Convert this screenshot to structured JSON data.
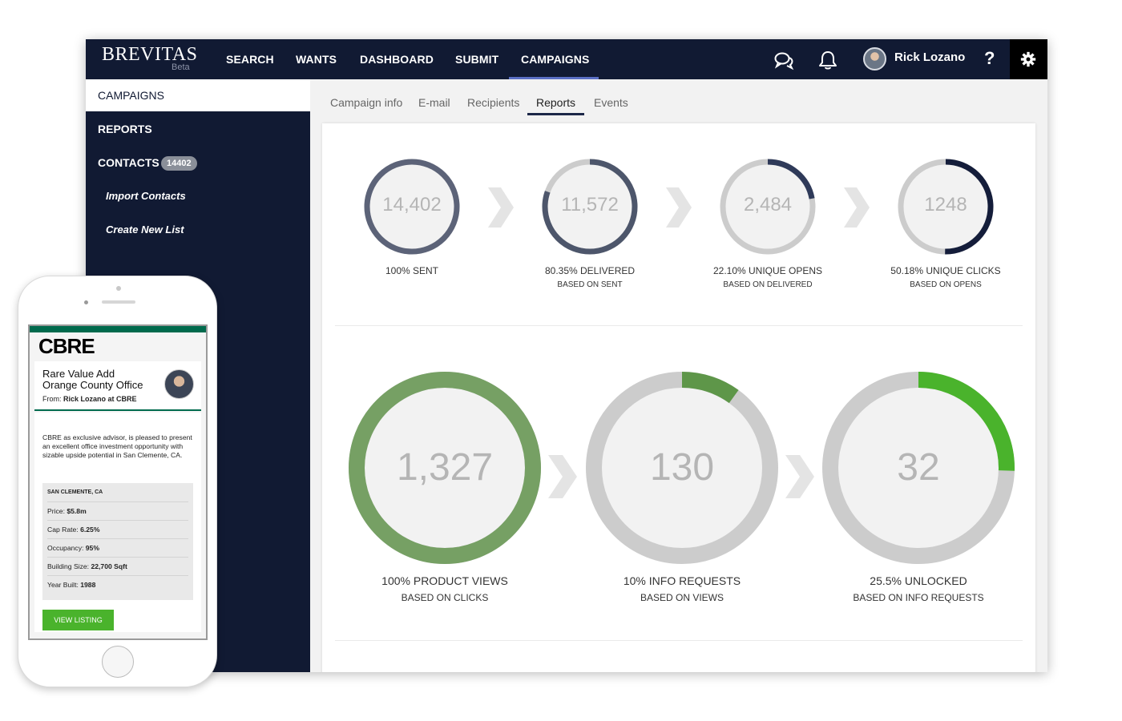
{
  "app": {
    "brand": "BREVITAS",
    "brand_sub": "Beta",
    "nav": [
      "SEARCH",
      "WANTS",
      "DASHBOARD",
      "SUBMIT",
      "CAMPAIGNS"
    ],
    "active_nav": "CAMPAIGNS",
    "user_name": "Rick Lozano",
    "help_label": "?",
    "icons": [
      "chat-bubbles-icon",
      "bell-icon",
      "avatar",
      "question-icon",
      "gear-icon"
    ],
    "colors": {
      "navbar": "#111a33",
      "accent_underline": "#5a6fc4",
      "green_dark": "#6f9c5e",
      "green_bright": "#4ab32c",
      "ring_gray": "#cccccc"
    }
  },
  "sidebar": {
    "items": [
      {
        "label": "CAMPAIGNS",
        "active": true
      },
      {
        "label": "REPORTS",
        "active": false
      },
      {
        "label": "CONTACTS",
        "badge": "14402",
        "active": false
      }
    ],
    "sub_items": [
      "Import Contacts",
      "Create New List"
    ]
  },
  "tabs": {
    "items": [
      "Campaign info",
      "E-mail",
      "Recipients",
      "Reports",
      "Events"
    ],
    "active": "Reports"
  },
  "email_funnel": [
    {
      "value": "14,402",
      "label": "100% SENT",
      "sub": "",
      "fraction": 1.0,
      "color": "#5c6378"
    },
    {
      "value": "11,572",
      "label": "80.35% DELIVERED",
      "sub": "BASED ON SENT",
      "fraction": 0.8035,
      "color": "#4d566b"
    },
    {
      "value": "2,484",
      "label": "22.10% UNIQUE OPENS",
      "sub": "BASED ON DELIVERED",
      "fraction": 0.221,
      "color": "#2f3a59"
    },
    {
      "value": "1248",
      "label": "50.18% UNIQUE CLICKS",
      "sub": "BASED ON OPENS",
      "fraction": 0.5018,
      "color": "#141d3a"
    }
  ],
  "engagement_funnel": [
    {
      "value": "1,327",
      "label": "100% PRODUCT VIEWS",
      "sub": "BASED ON CLICKS",
      "fraction": 1.0,
      "color": "#76a064"
    },
    {
      "value": "130",
      "label": "10% INFO REQUESTS",
      "sub": "BASED ON VIEWS",
      "fraction": 0.1,
      "color": "#5e9649"
    },
    {
      "value": "32",
      "label": "25.5% UNLOCKED",
      "sub": "BASED ON INFO REQUESTS",
      "fraction": 0.255,
      "color": "#4ab32c"
    }
  ],
  "phone_email": {
    "logo": "CBRE",
    "title_line1": "Rare Value Add",
    "title_line2": "Orange County Office",
    "from_label": "From:",
    "from_value": "Rick Lozano at CBRE",
    "body": "CBRE as exclusive advisor, is pleased to present an excellent office investment opportunity with sizable upside potential in San Clemente, CA.",
    "location": "SAN CLEMENTE, CA",
    "details": [
      {
        "label": "Price:",
        "value": "$5.8m"
      },
      {
        "label": "Cap Rate:",
        "value": "6.25%"
      },
      {
        "label": "Occupancy:",
        "value": "95%"
      },
      {
        "label": "Building Size:",
        "value": "22,700 Sqft"
      },
      {
        "label": "Year Built:",
        "value": "1988"
      }
    ],
    "button": "VIEW LISTING"
  }
}
